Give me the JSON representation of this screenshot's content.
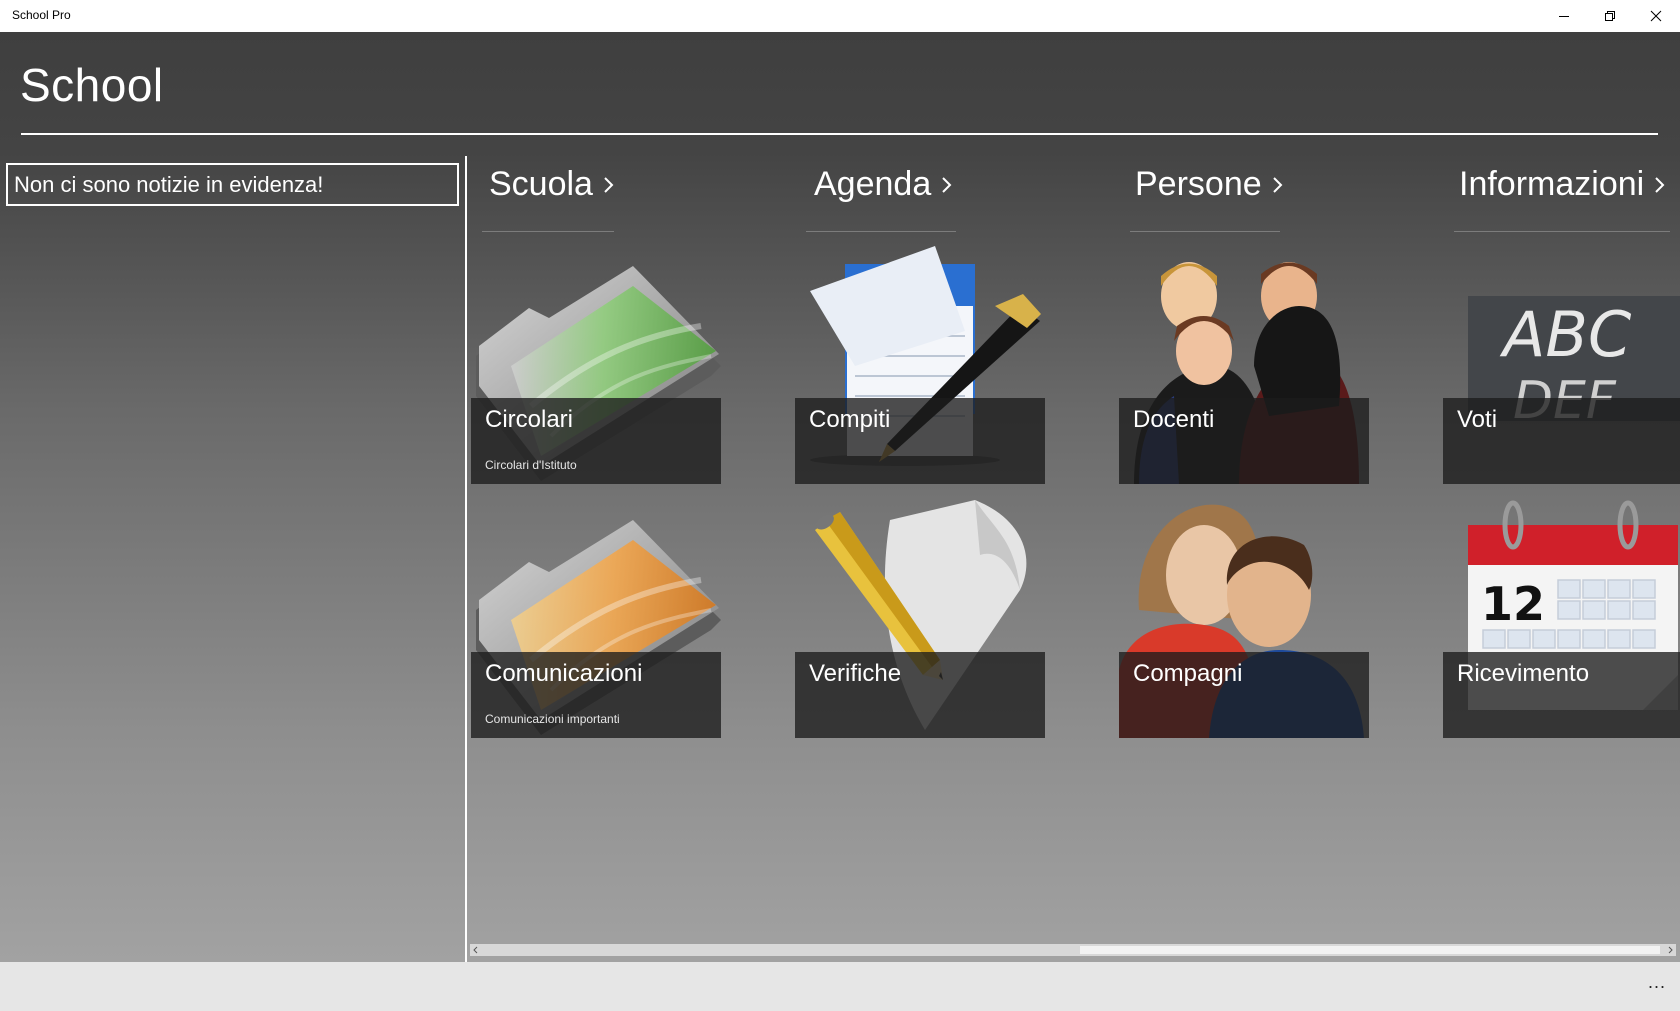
{
  "window": {
    "title": "School Pro",
    "minimize_icon": "minimize-icon",
    "restore_icon": "restore-icon",
    "close_icon": "close-icon"
  },
  "page": {
    "title": "School"
  },
  "news": {
    "message": "Non ci sono notizie in evidenza!"
  },
  "sections": [
    {
      "header": "Scuola",
      "tiles": [
        {
          "title": "Circolari",
          "subtitle": "Circolari d'Istituto",
          "icon": "green-folder-icon"
        },
        {
          "title": "Comunicazioni",
          "subtitle": "Comunicazioni importanti",
          "icon": "orange-folder-icon"
        }
      ]
    },
    {
      "header": "Agenda",
      "tiles": [
        {
          "title": "Compiti",
          "subtitle": "",
          "icon": "notepad-pen-icon"
        },
        {
          "title": "Verifiche",
          "subtitle": "",
          "icon": "pencil-paper-icon"
        }
      ]
    },
    {
      "header": "Persone",
      "tiles": [
        {
          "title": "Docenti",
          "subtitle": "",
          "icon": "teachers-icon"
        },
        {
          "title": "Compagni",
          "subtitle": "",
          "icon": "classmates-icon"
        }
      ]
    },
    {
      "header": "Informazioni",
      "tiles": [
        {
          "title": "Voti",
          "subtitle": "",
          "icon": "chalkboard-icon"
        },
        {
          "title": "Ricevimento",
          "subtitle": "",
          "icon": "calendar-icon",
          "calendar_day": "12"
        }
      ]
    }
  ],
  "chalkboard_text": {
    "line1": "ABC",
    "line2": "DEF"
  },
  "appbar": {
    "more_label": "..."
  },
  "colors": {
    "background_top": "#3f3f3f",
    "background_bottom": "#a2a2a2",
    "tile_overlay": "#1c1c1c",
    "text": "#ffffff",
    "appbar": "#e6e6e6"
  }
}
